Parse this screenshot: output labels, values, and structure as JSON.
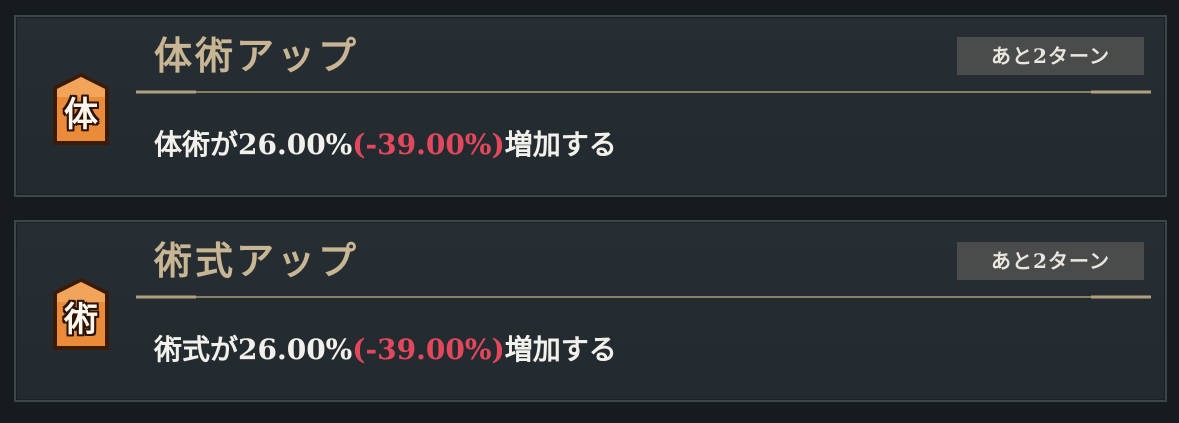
{
  "buffs": [
    {
      "icon_char": "体",
      "title": "体術アップ",
      "duration": "あと2ターン",
      "desc_before": "体術が26.00%",
      "desc_penalty": "(-39.00%)",
      "desc_after": "増加する"
    },
    {
      "icon_char": "術",
      "title": "術式アップ",
      "duration": "あと2ターン",
      "desc_before": "術式が26.00%",
      "desc_penalty": "(-39.00%)",
      "desc_after": "増加する"
    }
  ],
  "colors": {
    "panel": "#252c31",
    "title": "#c7b593",
    "penalty": "#e2475c",
    "badge_fill": "#e98b39",
    "duration_bg": "#4a4b4b"
  }
}
